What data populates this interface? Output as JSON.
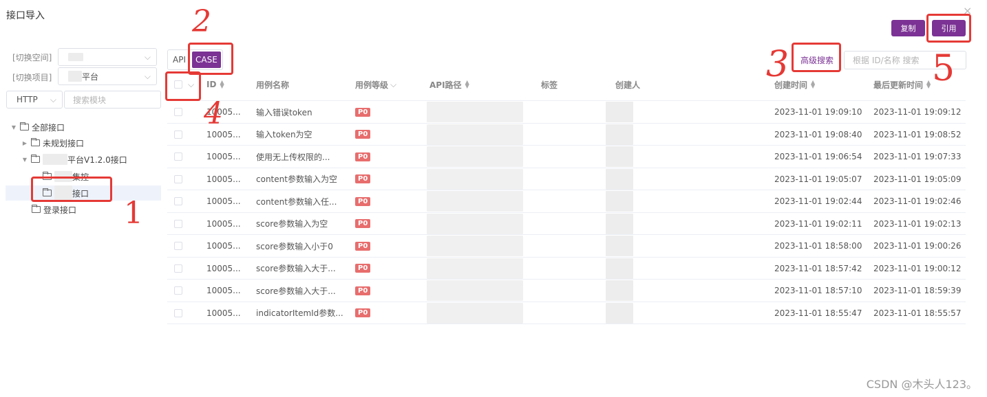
{
  "dialog": {
    "title": "接口导入",
    "close_glyph": "×"
  },
  "left": {
    "space_label": "[切换空间]",
    "project_label": "[切换项目]",
    "project_value_suffix": "平台",
    "protocol": "HTTP",
    "module_search_placeholder": "搜索模块"
  },
  "tree": {
    "root": "全部接口",
    "unplanned": "未规划接口",
    "platform_suffix": "平台V1.2.0接口",
    "child_a_suffix": "集控",
    "child_b_suffix": "接口",
    "login": "登录接口"
  },
  "toolbar": {
    "tab_api": "API",
    "tab_case": "CASE",
    "copy_label": "复制",
    "use_label": "引用",
    "advanced_search": "高级搜索",
    "search_placeholder": "根据 ID/名称 搜索"
  },
  "table": {
    "headers": {
      "id": "ID",
      "name": "用例名称",
      "level": "用例等级",
      "api_path": "API路径",
      "tags": "标签",
      "creator": "创建人",
      "created": "创建时间",
      "updated": "最后更新时间"
    },
    "rows": [
      {
        "id": "10005...",
        "name": "输入错误token",
        "level": "P0",
        "created": "2023-11-01 19:09:10",
        "updated": "2023-11-01 19:09:12"
      },
      {
        "id": "10005...",
        "name": "输入token为空",
        "level": "P0",
        "created": "2023-11-01 19:08:40",
        "updated": "2023-11-01 19:08:52"
      },
      {
        "id": "10005...",
        "name": "使用无上传权限的...",
        "level": "P0",
        "created": "2023-11-01 19:06:54",
        "updated": "2023-11-01 19:07:33"
      },
      {
        "id": "10005...",
        "name": "content参数输入为空",
        "level": "P0",
        "created": "2023-11-01 19:05:07",
        "updated": "2023-11-01 19:05:09"
      },
      {
        "id": "10005...",
        "name": "content参数输入任...",
        "level": "P0",
        "created": "2023-11-01 19:02:44",
        "updated": "2023-11-01 19:02:46"
      },
      {
        "id": "10005...",
        "name": "score参数输入为空",
        "level": "P0",
        "created": "2023-11-01 19:02:11",
        "updated": "2023-11-01 19:02:13"
      },
      {
        "id": "10005...",
        "name": "score参数输入小于0",
        "level": "P0",
        "created": "2023-11-01 18:58:00",
        "updated": "2023-11-01 19:00:26"
      },
      {
        "id": "10005...",
        "name": "score参数输入大于...",
        "level": "P0",
        "created": "2023-11-01 18:57:42",
        "updated": "2023-11-01 19:00:12"
      },
      {
        "id": "10005...",
        "name": "score参数输入大于...",
        "level": "P0",
        "created": "2023-11-01 18:57:10",
        "updated": "2023-11-01 18:59:39"
      },
      {
        "id": "10005...",
        "name": "indicatorItemId参数...",
        "level": "P0",
        "created": "2023-11-01 18:55:47",
        "updated": "2023-11-01 18:55:57"
      }
    ]
  },
  "annotations": {
    "n1": "1",
    "n2": "2",
    "n3": "3",
    "n4": "4",
    "n5": "5"
  },
  "watermark": "CSDN @木头人123。",
  "colors": {
    "accent": "#7b3294",
    "badge": "#e86d6d",
    "annotation": "#e53935"
  }
}
